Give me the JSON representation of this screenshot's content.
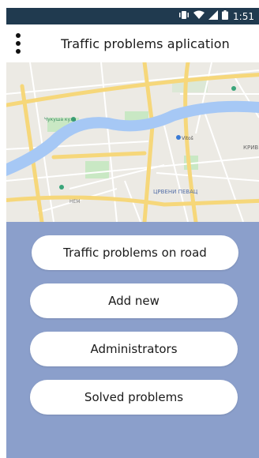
{
  "status_bar": {
    "time": "1:51",
    "icons": [
      "vibrate-icon",
      "wifi-icon",
      "signal-icon",
      "battery-icon"
    ]
  },
  "app_bar": {
    "title": "Traffic problems aplication",
    "menu_icon": "more-vert-icon"
  },
  "map": {
    "labels": [
      "ЦРВЕНИ ПЕВАЦ",
      "Vitoš",
      "КРИВ",
      "Чукуша кула",
      "НЕМ"
    ]
  },
  "menu": {
    "buttons": [
      {
        "label": "Traffic problems on road"
      },
      {
        "label": "Add new"
      },
      {
        "label": "Administrators"
      },
      {
        "label": "Solved problems"
      }
    ]
  },
  "colors": {
    "status_bar": "#203a4f",
    "panel": "#8b9fcb",
    "button": "#ffffff",
    "river": "#a6c8f5",
    "road": "#f6d77a"
  }
}
